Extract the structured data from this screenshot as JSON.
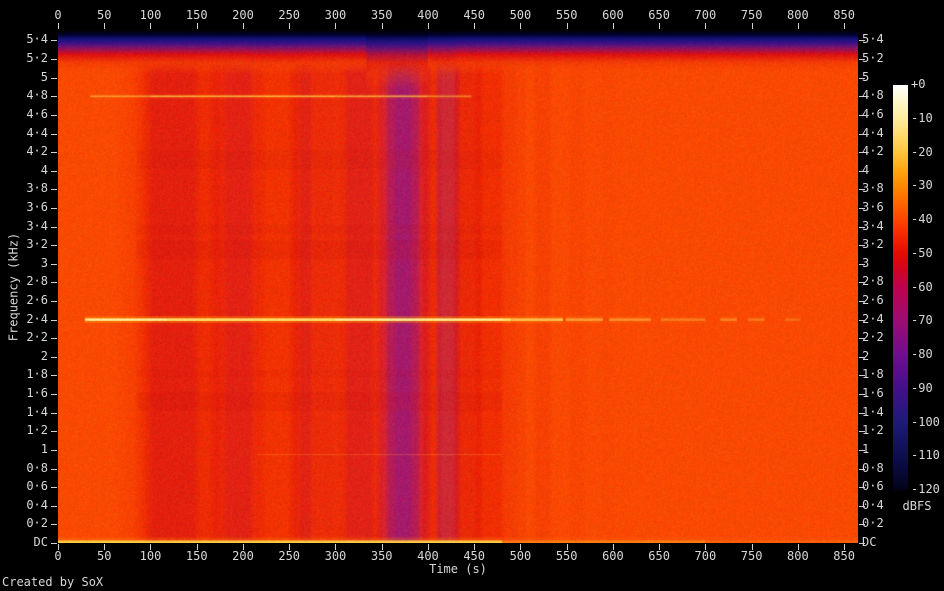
{
  "credit": "Created by SoX",
  "axes": {
    "x": {
      "label": "Time (s)",
      "ticks": [
        {
          "v": 0,
          "t": "0"
        },
        {
          "v": 50,
          "t": "50"
        },
        {
          "v": 100,
          "t": "100"
        },
        {
          "v": 150,
          "t": "150"
        },
        {
          "v": 200,
          "t": "200"
        },
        {
          "v": 250,
          "t": "250"
        },
        {
          "v": 300,
          "t": "300"
        },
        {
          "v": 350,
          "t": "350"
        },
        {
          "v": 400,
          "t": "400"
        },
        {
          "v": 450,
          "t": "450"
        },
        {
          "v": 500,
          "t": "500"
        },
        {
          "v": 550,
          "t": "550"
        },
        {
          "v": 600,
          "t": "600"
        },
        {
          "v": 650,
          "t": "650"
        },
        {
          "v": 700,
          "t": "700"
        },
        {
          "v": 750,
          "t": "750"
        },
        {
          "v": 800,
          "t": "800"
        },
        {
          "v": 850,
          "t": "850"
        }
      ]
    },
    "y": {
      "label": "Frequency (kHz)",
      "ticks": [
        {
          "v": 0,
          "t": "DC"
        },
        {
          "v": 0.2,
          "t": "0·2"
        },
        {
          "v": 0.4,
          "t": "0·4"
        },
        {
          "v": 0.6,
          "t": "0·6"
        },
        {
          "v": 0.8,
          "t": "0·8"
        },
        {
          "v": 1,
          "t": "1"
        },
        {
          "v": 1.2,
          "t": "1·2"
        },
        {
          "v": 1.4,
          "t": "1·4"
        },
        {
          "v": 1.6,
          "t": "1·6"
        },
        {
          "v": 1.8,
          "t": "1·8"
        },
        {
          "v": 2,
          "t": "2"
        },
        {
          "v": 2.2,
          "t": "2·2"
        },
        {
          "v": 2.4,
          "t": "2·4"
        },
        {
          "v": 2.6,
          "t": "2·6"
        },
        {
          "v": 2.8,
          "t": "2·8"
        },
        {
          "v": 3,
          "t": "3"
        },
        {
          "v": 3.2,
          "t": "3·2"
        },
        {
          "v": 3.4,
          "t": "3·4"
        },
        {
          "v": 3.6,
          "t": "3·6"
        },
        {
          "v": 3.8,
          "t": "3·8"
        },
        {
          "v": 4,
          "t": "4"
        },
        {
          "v": 4.2,
          "t": "4·2"
        },
        {
          "v": 4.4,
          "t": "4·4"
        },
        {
          "v": 4.6,
          "t": "4·6"
        },
        {
          "v": 4.8,
          "t": "4·8"
        },
        {
          "v": 5,
          "t": "5"
        },
        {
          "v": 5.2,
          "t": "5·2"
        },
        {
          "v": 5.4,
          "t": "5·4"
        }
      ]
    },
    "legend": {
      "caption": "dBFS",
      "ticks": [
        {
          "v": 0,
          "t": "+0"
        },
        {
          "v": -10,
          "t": "-10"
        },
        {
          "v": -20,
          "t": "-20"
        },
        {
          "v": -30,
          "t": "-30"
        },
        {
          "v": -40,
          "t": "-40"
        },
        {
          "v": -50,
          "t": "-50"
        },
        {
          "v": -60,
          "t": "-60"
        },
        {
          "v": -70,
          "t": "-70"
        },
        {
          "v": -80,
          "t": "-80"
        },
        {
          "v": -90,
          "t": "-90"
        },
        {
          "v": -100,
          "t": "-100"
        },
        {
          "v": -110,
          "t": "-110"
        },
        {
          "v": -120,
          "t": "-120"
        }
      ]
    }
  },
  "chart_data": {
    "type": "heatmap",
    "title": "SoX audio spectrogram",
    "xlabel": "Time (s)",
    "ylabel": "Frequency (kHz)",
    "zlabel": "dBFS",
    "x_range_s": [
      0,
      865
    ],
    "y_range_khz": [
      0,
      5.5125
    ],
    "z_range_dbfs": [
      -120,
      0
    ],
    "base_color": "#fb4903",
    "palette": [
      {
        "db": 0,
        "c": "#ffffff"
      },
      {
        "db": -5,
        "c": "#fff6c8"
      },
      {
        "db": -10,
        "c": "#ffeb9b"
      },
      {
        "db": -15,
        "c": "#ffd96b"
      },
      {
        "db": -20,
        "c": "#ffc43e"
      },
      {
        "db": -25,
        "c": "#ffa713"
      },
      {
        "db": -30,
        "c": "#ff8800"
      },
      {
        "db": -35,
        "c": "#ff6600"
      },
      {
        "db": -40,
        "c": "#fe4400"
      },
      {
        "db": -45,
        "c": "#f32500"
      },
      {
        "db": -50,
        "c": "#e30b00"
      },
      {
        "db": -55,
        "c": "#d00322"
      },
      {
        "db": -60,
        "c": "#bd0350"
      },
      {
        "db": -70,
        "c": "#9b0c72"
      },
      {
        "db": -80,
        "c": "#6f0d90"
      },
      {
        "db": -90,
        "c": "#43108a"
      },
      {
        "db": -100,
        "c": "#1d1a78"
      },
      {
        "db": -110,
        "c": "#0e0e4e"
      },
      {
        "db": -120,
        "c": "#03031a"
      }
    ],
    "features": {
      "top_band": {
        "height": 44,
        "stops": [
          [
            0,
            "#000000",
            1
          ],
          [
            0.1,
            "#01012a",
            1
          ],
          [
            0.2,
            "#14127a",
            1
          ],
          [
            0.3,
            "#3d1186",
            1
          ],
          [
            0.38,
            "#701472",
            1
          ],
          [
            0.47,
            "#a81148",
            1
          ],
          [
            0.56,
            "#dd1010",
            1
          ],
          [
            0.74,
            "#f13a06",
            0.85
          ],
          [
            1,
            "#fb4903",
            0
          ]
        ],
        "notches": [
          {
            "t0": 333,
            "t1": 400,
            "stretch": 1.35,
            "a": 0.5
          },
          {
            "t0": 403,
            "t1": 430,
            "stretch": 1.18,
            "a": 0.3
          },
          {
            "t0": 208,
            "t1": 262,
            "stretch": 1.08,
            "a": 0.2
          }
        ]
      },
      "vertical_bands": [
        {
          "t0": 82,
          "t1": 480,
          "c": "#ee2601",
          "a": 0.25,
          "f": 20
        },
        {
          "t0": 95,
          "t1": 170,
          "c": "#e00f08",
          "a": 0.4,
          "f": 12
        },
        {
          "t0": 103,
          "t1": 146,
          "c": "#cf0a20",
          "a": 0.35,
          "f": 8
        },
        {
          "t0": 172,
          "t1": 216,
          "c": "#de0d12",
          "a": 0.4,
          "f": 9
        },
        {
          "t0": 184,
          "t1": 207,
          "c": "#c90c2c",
          "a": 0.3,
          "f": 6
        },
        {
          "t0": 222,
          "t1": 257,
          "c": "#e41402",
          "a": 0.32,
          "f": 9
        },
        {
          "t0": 257,
          "t1": 296,
          "c": "#d90d14",
          "a": 0.4,
          "f": 8
        },
        {
          "t0": 264,
          "t1": 272,
          "c": "#c30c36",
          "a": 0.25,
          "f": 3
        },
        {
          "t0": 305,
          "t1": 346,
          "c": "#dc0e10",
          "a": 0.42,
          "f": 8
        },
        {
          "t0": 314,
          "t1": 338,
          "c": "#c70e38",
          "a": 0.3,
          "f": 5
        },
        {
          "t0": 350,
          "t1": 398,
          "c": "#c20c4e",
          "a": 0.5,
          "f": 6
        },
        {
          "t0": 358,
          "t1": 388,
          "c": "#971478",
          "a": 0.55,
          "f": 5
        },
        {
          "t0": 366,
          "t1": 380,
          "c": "#861692",
          "a": 0.35,
          "f": 4
        },
        {
          "t0": 396,
          "t1": 412,
          "c": "#d80e12",
          "a": 0.4,
          "f": 4
        },
        {
          "t0": 413,
          "t1": 431,
          "c": "#a61264",
          "a": 0.5,
          "f": 5
        },
        {
          "t0": 431,
          "t1": 455,
          "c": "#db0e0e",
          "a": 0.45,
          "f": 5
        },
        {
          "t0": 455,
          "t1": 478,
          "c": "#e61504",
          "a": 0.42,
          "f": 5
        },
        {
          "t0": 483,
          "t1": 493,
          "c": "#e8270b",
          "a": 0.25,
          "f": 4
        },
        {
          "t0": 496,
          "t1": 504,
          "c": "#ea2d06",
          "a": 0.22,
          "f": 3
        },
        {
          "t0": 518,
          "t1": 530,
          "c": "#e92a06",
          "a": 0.25,
          "f": 5
        },
        {
          "t0": 556,
          "t1": 567,
          "c": "#ee3504",
          "a": 0.18,
          "f": 5
        },
        {
          "t0": 590,
          "t1": 599,
          "c": "#f03b02",
          "a": 0.12,
          "f": 4
        }
      ],
      "h_smears": [
        {
          "f0": 3.05,
          "f1": 3.25,
          "t0": 85,
          "t1": 480,
          "c": "#c81010",
          "a": 0.14
        },
        {
          "f0": 3.32,
          "f1": 3.42,
          "t0": 85,
          "t1": 480,
          "c": "#c81010",
          "a": 0.1
        },
        {
          "f0": 4.02,
          "f1": 4.22,
          "t0": 85,
          "t1": 480,
          "c": "#c81010",
          "a": 0.1
        },
        {
          "f0": 1.42,
          "f1": 1.62,
          "t0": 85,
          "t1": 480,
          "c": "#c81010",
          "a": 0.13
        },
        {
          "f0": 1.78,
          "f1": 1.86,
          "t0": 85,
          "t1": 480,
          "c": "#c81010",
          "a": 0.08
        }
      ],
      "tonal_lines": [
        {
          "f": 2.4,
          "h": 2.6,
          "c": "#ffe26a",
          "glow": {
            "h": 7,
            "c": "#ff9900",
            "a": 0.35
          },
          "segments": [
            {
              "t0": 29,
              "t1": 490,
              "a": 1.0
            },
            {
              "t0": 490,
              "t1": 546,
              "a": 0.75
            },
            {
              "t0": 549,
              "t1": 589,
              "a": 0.5
            },
            {
              "t0": 596,
              "t1": 641,
              "a": 0.42
            },
            {
              "t0": 652,
              "t1": 700,
              "a": 0.28
            },
            {
              "t0": 716,
              "t1": 734,
              "a": 0.32
            },
            {
              "t0": 746,
              "t1": 764,
              "a": 0.26
            },
            {
              "t0": 786,
              "t1": 803,
              "a": 0.2
            }
          ],
          "kc": "#fff6bb",
          "kh": 1.4,
          "kernels": [
            {
              "t0": 32,
              "t1": 118,
              "a": 0.8
            },
            {
              "t0": 300,
              "t1": 480,
              "a": 0.7
            }
          ]
        },
        {
          "f": 4.8,
          "h": 1.6,
          "c": "#ffc84e",
          "glow": {
            "h": 4,
            "c": "#ff9a00",
            "a": 0.22
          },
          "segments": [
            {
              "t0": 35,
              "t1": 100,
              "a": 0.6
            },
            {
              "t0": 100,
              "t1": 300,
              "a": 0.8
            },
            {
              "t0": 300,
              "t1": 400,
              "a": 0.7
            },
            {
              "t0": 400,
              "t1": 447,
              "a": 0.5
            }
          ]
        },
        {
          "f": 0.95,
          "h": 1.2,
          "c": "#ffb040",
          "segments": [
            {
              "t0": 215,
              "t1": 480,
              "a": 0.22
            }
          ]
        }
      ],
      "dc_line": {
        "h": 2.6,
        "glow": {
          "h": 3,
          "c": "#ff8a00",
          "a": 0.25
        },
        "segments": [
          {
            "t0": 0,
            "t1": 480,
            "a": 0.95,
            "c": "#ffd246"
          },
          {
            "t0": 480,
            "t1": 700,
            "a": 0.5,
            "c": "#ffb028"
          },
          {
            "t0": 700,
            "t1": 865,
            "a": 0.28,
            "c": "#ff9a20"
          }
        ]
      },
      "noise": {
        "r": 26,
        "g": 18,
        "b": 8
      }
    }
  }
}
